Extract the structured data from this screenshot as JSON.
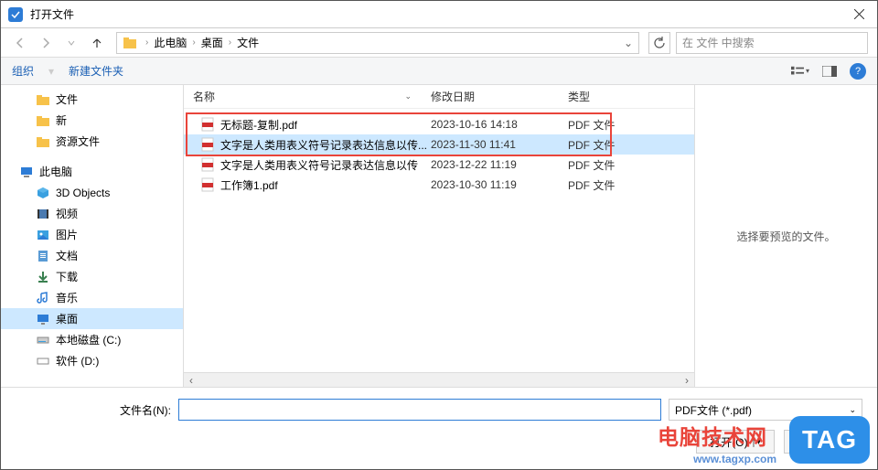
{
  "title": "打开文件",
  "breadcrumb": {
    "items": [
      "此电脑",
      "桌面",
      "文件"
    ]
  },
  "search": {
    "placeholder": "在 文件 中搜索"
  },
  "toolbar": {
    "organize": "组织",
    "newfolder": "新建文件夹"
  },
  "sidebar": {
    "quick": [
      {
        "label": "文件",
        "icon": "folder"
      },
      {
        "label": "新",
        "icon": "folder"
      },
      {
        "label": "资源文件",
        "icon": "folder"
      }
    ],
    "thispc": {
      "label": "此电脑"
    },
    "pc_items": [
      {
        "label": "3D Objects",
        "icon": "3d"
      },
      {
        "label": "视频",
        "icon": "video"
      },
      {
        "label": "图片",
        "icon": "pictures"
      },
      {
        "label": "文档",
        "icon": "docs"
      },
      {
        "label": "下载",
        "icon": "downloads"
      },
      {
        "label": "音乐",
        "icon": "music"
      },
      {
        "label": "桌面",
        "icon": "desktop",
        "selected": true
      },
      {
        "label": "本地磁盘 (C:)",
        "icon": "disk"
      },
      {
        "label": "软件 (D:)",
        "icon": "disk"
      }
    ]
  },
  "columns": {
    "name": "名称",
    "date": "修改日期",
    "type": "类型"
  },
  "files": [
    {
      "name": "无标题-复制.pdf",
      "date": "2023-10-16 14:18",
      "type": "PDF 文件"
    },
    {
      "name": "文字是人类用表义符号记录表达信息以传...",
      "date": "2023-11-30 11:41",
      "type": "PDF 文件",
      "selected": true
    },
    {
      "name": "文字是人类用表义符号记录表达信息以传",
      "date": "2023-12-22 11:19",
      "type": "PDF 文件"
    },
    {
      "name": "工作簿1.pdf",
      "date": "2023-10-30 11:19",
      "type": "PDF 文件"
    }
  ],
  "preview": {
    "text": "选择要预览的文件。"
  },
  "footer": {
    "filename_label": "文件名(N):",
    "type_filter": "PDF文件 (*.pdf)",
    "open": "打开(O)",
    "cancel": "取消"
  },
  "watermark": {
    "brand": "电脑技术网",
    "url": "www.tagxp.com",
    "tag": "TAG"
  }
}
